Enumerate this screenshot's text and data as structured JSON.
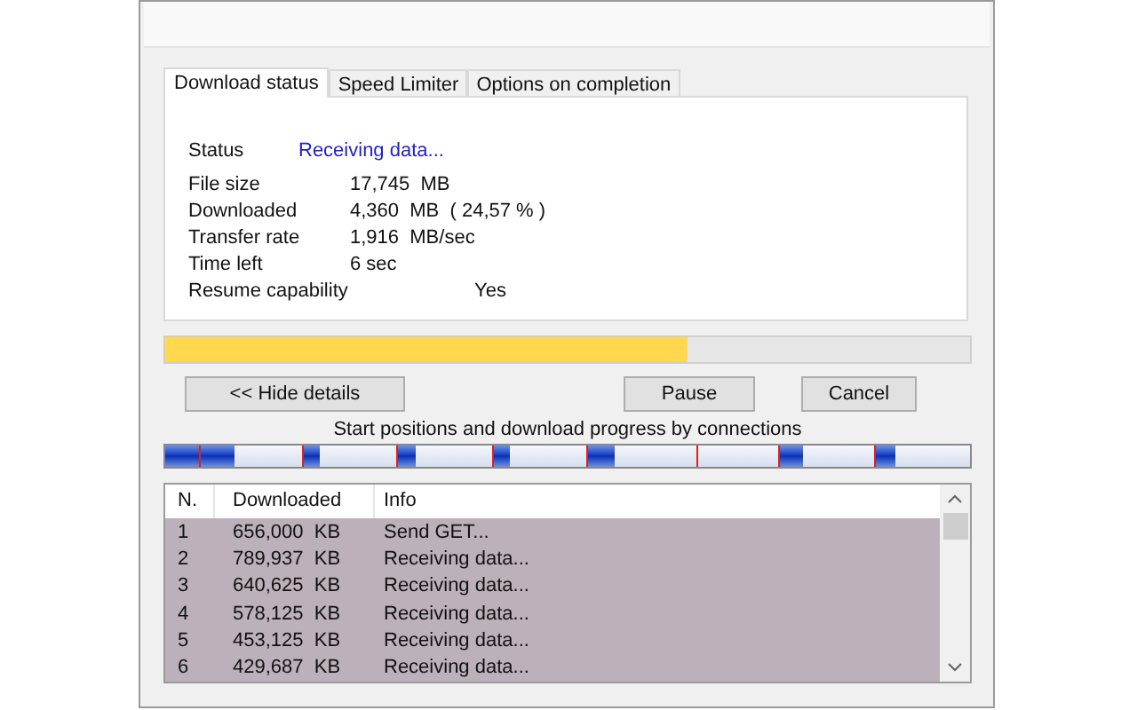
{
  "tabs": [
    {
      "label": "Download status",
      "selected": true
    },
    {
      "label": "Speed Limiter",
      "selected": false
    },
    {
      "label": "Options on completion",
      "selected": false
    }
  ],
  "status": {
    "label": "Status",
    "value": "Receiving data..."
  },
  "details": [
    {
      "label": "File size",
      "value": "17,745  MB"
    },
    {
      "label": "Downloaded",
      "value": "4,360  MB  ( 24,57 % )"
    },
    {
      "label": "Transfer rate",
      "value": "1,916  MB/sec"
    },
    {
      "label": "Time left",
      "value": "6 sec"
    }
  ],
  "resume": {
    "label": "Resume capability",
    "value": "Yes"
  },
  "progress": {
    "level": 0.65
  },
  "buttons": {
    "hide": "<< Hide details",
    "pause": "Pause",
    "cancel": "Cancel"
  },
  "connections_caption": "Start positions and download progress by connections",
  "table": {
    "columns": [
      "N.",
      "Downloaded",
      "Info"
    ],
    "rows": [
      [
        "1",
        "656,000  KB",
        "Send GET..."
      ],
      [
        "2",
        "789,937  KB",
        "Receiving data..."
      ],
      [
        "3",
        "640,625  KB",
        "Receiving data..."
      ],
      [
        "4",
        "578,125  KB",
        "Receiving data..."
      ],
      [
        "5",
        "453,125  KB",
        "Receiving data..."
      ],
      [
        "6",
        "429,687  KB",
        "Receiving data..."
      ]
    ]
  }
}
